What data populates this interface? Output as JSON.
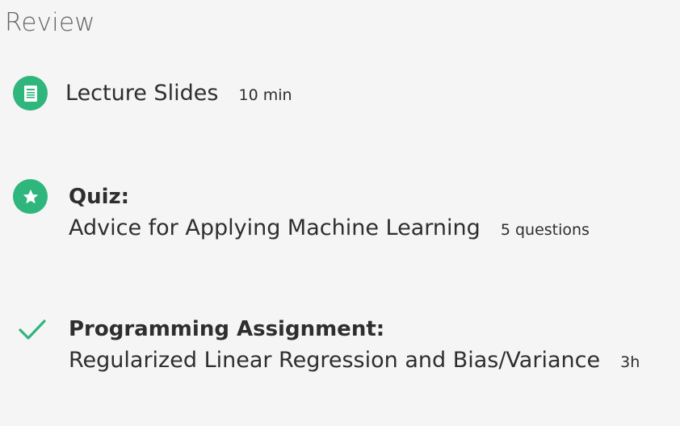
{
  "section": {
    "title": "Review"
  },
  "items": [
    {
      "icon": "document-icon",
      "title": "Lecture Slides",
      "meta": "10 min"
    },
    {
      "icon": "star-icon",
      "type_label": "Quiz:",
      "name": "Advice for Applying Machine Learning",
      "meta": "5 questions"
    },
    {
      "icon": "checkmark-icon",
      "type_label": "Programming Assignment:",
      "name": "Regularized Linear Regression and Bias/Variance",
      "meta": "3h",
      "completed": true
    }
  ],
  "colors": {
    "accent": "#2fb67c",
    "text": "#2e2e2e",
    "heading": "#666666",
    "background": "#f5f5f5"
  }
}
